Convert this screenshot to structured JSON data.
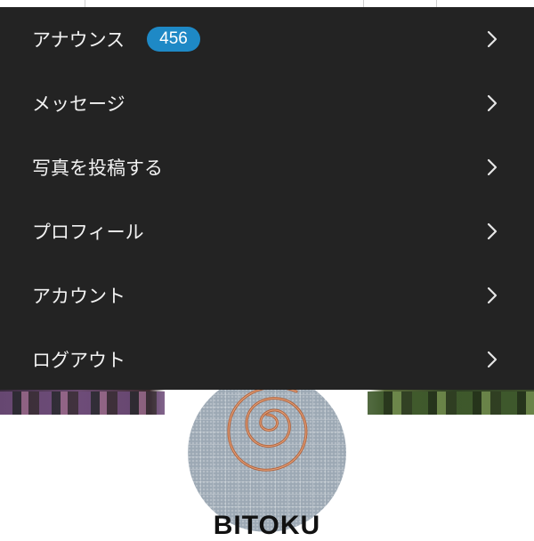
{
  "menu": {
    "items": [
      {
        "label": "アナウンス",
        "badge": "456"
      },
      {
        "label": "メッセージ"
      },
      {
        "label": "写真を投稿する"
      },
      {
        "label": "プロフィール"
      },
      {
        "label": "アカウント"
      },
      {
        "label": "ログアウト"
      }
    ],
    "chevron_icon": "chevron-right-icon"
  },
  "profile": {
    "name": "BITOKU"
  },
  "colors": {
    "menu_background": "#232323",
    "menu_text": "#f2f2f2",
    "badge_background": "#1e89c6",
    "chevron": "#e6e6e6"
  }
}
